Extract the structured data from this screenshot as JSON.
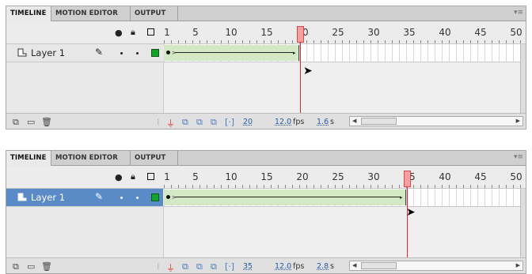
{
  "panels": [
    {
      "tabs": [
        {
          "label": "TIMELINE",
          "active": true
        },
        {
          "label": "MOTION EDITOR",
          "active": false
        },
        {
          "label": "OUTPUT",
          "active": false
        }
      ],
      "ruler_numbers": [
        "1",
        "5",
        "10",
        "15",
        "20",
        "25",
        "30",
        "35",
        "40",
        "45",
        "50"
      ],
      "layer": {
        "name": "Layer 1",
        "selected": false,
        "color": "#14a32a"
      },
      "current_frame": "20",
      "fps": "12.0",
      "fps_unit": "fps",
      "elapsed": "1.6",
      "elapsed_unit": "s",
      "tween_end_frame": 19,
      "playhead_frame": 20
    },
    {
      "tabs": [
        {
          "label": "TIMELINE",
          "active": true
        },
        {
          "label": "MOTION EDITOR",
          "active": false
        },
        {
          "label": "OUTPUT",
          "active": false
        }
      ],
      "ruler_numbers": [
        "1",
        "5",
        "10",
        "15",
        "20",
        "25",
        "30",
        "35",
        "40",
        "45",
        "50"
      ],
      "layer": {
        "name": "Layer 1",
        "selected": true,
        "color": "#14a32a"
      },
      "current_frame": "35",
      "fps": "12.0",
      "fps_unit": "fps",
      "elapsed": "2.8",
      "elapsed_unit": "s",
      "tween_end_frame": 34,
      "playhead_frame": 35
    }
  ],
  "icons": {
    "eye": "eye-icon",
    "lock": "lock-icon",
    "outline": "outline-icon",
    "pencil": "pencil-icon",
    "new_layer": "new-layer-icon",
    "new_folder": "new-folder-icon",
    "delete": "trash-icon",
    "onion": "onion-skin-icon",
    "edit_multiple": "edit-multiple-frames-icon",
    "center": "center-frame-icon"
  },
  "colors": {
    "playhead": "#e0282a",
    "tween": "#d3e9c5",
    "selected_layer": "#5b8bc7",
    "layer_color": "#14a32a"
  }
}
